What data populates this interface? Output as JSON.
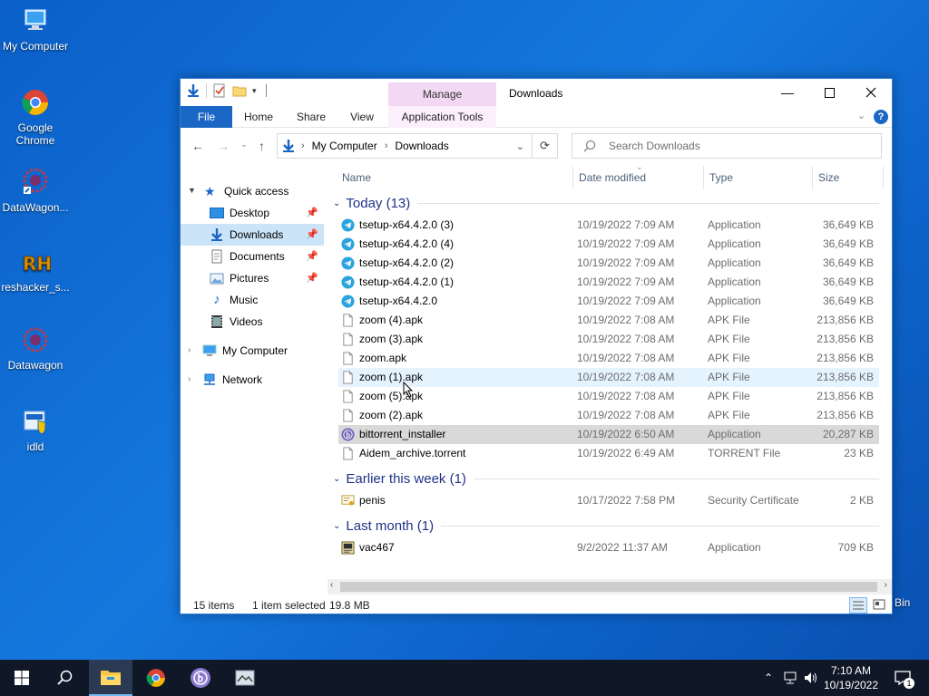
{
  "desktop": {
    "icons": [
      {
        "label": "My Computer"
      },
      {
        "label": "Google Chrome"
      },
      {
        "label": "DataWagon..."
      },
      {
        "label": "reshacker_s..."
      },
      {
        "label": "Datawagon"
      },
      {
        "label": "idld"
      }
    ],
    "recycle_partial": "Bin"
  },
  "window": {
    "title": "Downloads",
    "manage_label": "Manage",
    "ribbon_tabs": [
      "File",
      "Home",
      "Share",
      "View",
      "Application Tools"
    ],
    "address": {
      "crumbs": [
        "My Computer",
        "Downloads"
      ]
    },
    "search_placeholder": "Search Downloads"
  },
  "nav": {
    "quick_access": "Quick access",
    "items": [
      "Desktop",
      "Downloads",
      "Documents",
      "Pictures",
      "Music",
      "Videos"
    ],
    "my_computer": "My Computer",
    "network": "Network"
  },
  "columns": {
    "name": "Name",
    "date": "Date modified",
    "type": "Type",
    "size": "Size"
  },
  "groups": [
    {
      "label": "Today (13)",
      "files": [
        {
          "name": "tsetup-x64.4.2.0 (3)",
          "date": "10/19/2022 7:09 AM",
          "type": "Application",
          "size": "36,649 KB",
          "icon": "telegram-icon"
        },
        {
          "name": "tsetup-x64.4.2.0 (4)",
          "date": "10/19/2022 7:09 AM",
          "type": "Application",
          "size": "36,649 KB",
          "icon": "telegram-icon"
        },
        {
          "name": "tsetup-x64.4.2.0 (2)",
          "date": "10/19/2022 7:09 AM",
          "type": "Application",
          "size": "36,649 KB",
          "icon": "telegram-icon"
        },
        {
          "name": "tsetup-x64.4.2.0 (1)",
          "date": "10/19/2022 7:09 AM",
          "type": "Application",
          "size": "36,649 KB",
          "icon": "telegram-icon"
        },
        {
          "name": "tsetup-x64.4.2.0",
          "date": "10/19/2022 7:09 AM",
          "type": "Application",
          "size": "36,649 KB",
          "icon": "telegram-icon"
        },
        {
          "name": "zoom (4).apk",
          "date": "10/19/2022 7:08 AM",
          "type": "APK File",
          "size": "213,856 KB",
          "icon": "file-icon"
        },
        {
          "name": "zoom (3).apk",
          "date": "10/19/2022 7:08 AM",
          "type": "APK File",
          "size": "213,856 KB",
          "icon": "file-icon"
        },
        {
          "name": "zoom.apk",
          "date": "10/19/2022 7:08 AM",
          "type": "APK File",
          "size": "213,856 KB",
          "icon": "file-icon"
        },
        {
          "name": "zoom (1).apk",
          "date": "10/19/2022 7:08 AM",
          "type": "APK File",
          "size": "213,856 KB",
          "icon": "file-icon"
        },
        {
          "name": "zoom (5).apk",
          "date": "10/19/2022 7:08 AM",
          "type": "APK File",
          "size": "213,856 KB",
          "icon": "file-icon"
        },
        {
          "name": "zoom (2).apk",
          "date": "10/19/2022 7:08 AM",
          "type": "APK File",
          "size": "213,856 KB",
          "icon": "file-icon"
        },
        {
          "name": "bittorrent_installer",
          "date": "10/19/2022 6:50 AM",
          "type": "Application",
          "size": "20,287 KB",
          "icon": "bittorrent-icon"
        },
        {
          "name": "Aidem_archive.torrent",
          "date": "10/19/2022 6:49 AM",
          "type": "TORRENT File",
          "size": "23 KB",
          "icon": "file-icon"
        }
      ]
    },
    {
      "label": "Earlier this week (1)",
      "files": [
        {
          "name": "penis",
          "date": "10/17/2022 7:58 PM",
          "type": "Security Certificate",
          "size": "2 KB",
          "icon": "certificate-icon"
        }
      ]
    },
    {
      "label": "Last month (1)",
      "files": [
        {
          "name": "vac467",
          "date": "9/2/2022 11:37 AM",
          "type": "Application",
          "size": "709 KB",
          "icon": "app-icon"
        }
      ]
    }
  ],
  "status": {
    "count": "15 items",
    "selected": "1 item selected",
    "size": "19.8 MB"
  },
  "clock": {
    "time": "7:10 AM",
    "date": "10/19/2022"
  },
  "notifications_count": "1",
  "colors": {
    "accent": "#1a66c4",
    "selected_row": "#d9d9d9",
    "hover_row": "#e5f3ff",
    "nav_selected": "#cce4f7",
    "group_header": "#1e3287",
    "taskbar": "#101828"
  }
}
